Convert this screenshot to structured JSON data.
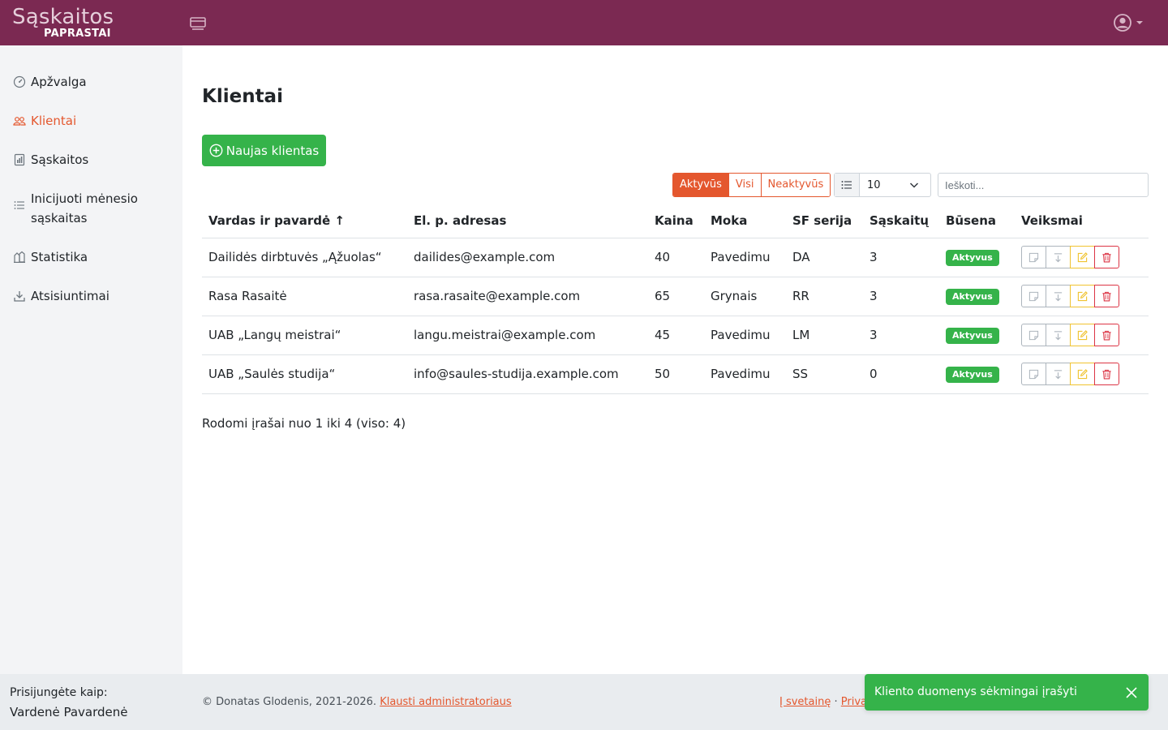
{
  "header": {
    "logo_main": "Sąskaitos",
    "logo_sub": "PAPRASTAI",
    "menu_icon": "sidebar-toggle-icon",
    "user_icon": "user-circle-icon"
  },
  "sidebar": {
    "items": [
      {
        "label": "Apžvalga",
        "icon": "dashboard-icon",
        "active": false
      },
      {
        "label": "Klientai",
        "icon": "people-icon",
        "active": true
      },
      {
        "label": "Sąskaitos",
        "icon": "receipt-icon",
        "active": false
      },
      {
        "label": "Inicijuoti mėnesio sąskaitas",
        "icon": "list-icon",
        "active": false
      },
      {
        "label": "Statistika",
        "icon": "chart-icon",
        "active": false
      },
      {
        "label": "Atsisiuntimai",
        "icon": "download-icon",
        "active": false
      }
    ]
  },
  "main": {
    "title": "Klientai",
    "new_button": "Naujas klientas",
    "filters": [
      "Aktyvūs",
      "Visi",
      "Neaktyvūs"
    ],
    "active_filter": "Aktyvūs",
    "page_size": "10",
    "search_placeholder": "Ieškoti...",
    "columns": [
      "Vardas ir pavardė ↑",
      "El. p. adresas",
      "Kaina",
      "Moka",
      "SF serija",
      "Sąskaitų",
      "Būsena",
      "Veiksmai"
    ],
    "rows": [
      {
        "name": "Dailidės dirbtuvės „Ąžuolas“",
        "email": "dailides@example.com",
        "price": "40",
        "pays": "Pavedimu",
        "series": "DA",
        "invoices": "3",
        "status": "Aktyvus"
      },
      {
        "name": "Rasa Rasaitė",
        "email": "rasa.rasaite@example.com",
        "price": "65",
        "pays": "Grynais",
        "series": "RR",
        "invoices": "3",
        "status": "Aktyvus"
      },
      {
        "name": "UAB „Langų meistrai“",
        "email": "langu.meistrai@example.com",
        "price": "45",
        "pays": "Pavedimu",
        "series": "LM",
        "invoices": "3",
        "status": "Aktyvus"
      },
      {
        "name": "UAB „Saulės studija“",
        "email": "info@saules-studija.example.com",
        "price": "50",
        "pays": "Pavedimu",
        "series": "SS",
        "invoices": "0",
        "status": "Aktyvus"
      }
    ],
    "records_info": "Rodomi įrašai nuo 1 iki 4 (viso: 4)"
  },
  "footer": {
    "logged_in_label": "Prisijungėte kaip:",
    "user_name": "Vardenė Pavardenė",
    "copyright": "© Donatas Glodenis, 2021-2026.",
    "ask_admin": "Klausti administratoriaus",
    "about_link": "Į svetainę",
    "separator": "·",
    "privacy_link": "Privat"
  },
  "toast": {
    "message": "Kliento duomenys sėkmingai įrašyti"
  },
  "colors": {
    "brand": "#7b2952",
    "accent": "#e4572e",
    "success": "#35b34a",
    "danger": "#dc3545",
    "warning": "#f0c330"
  }
}
